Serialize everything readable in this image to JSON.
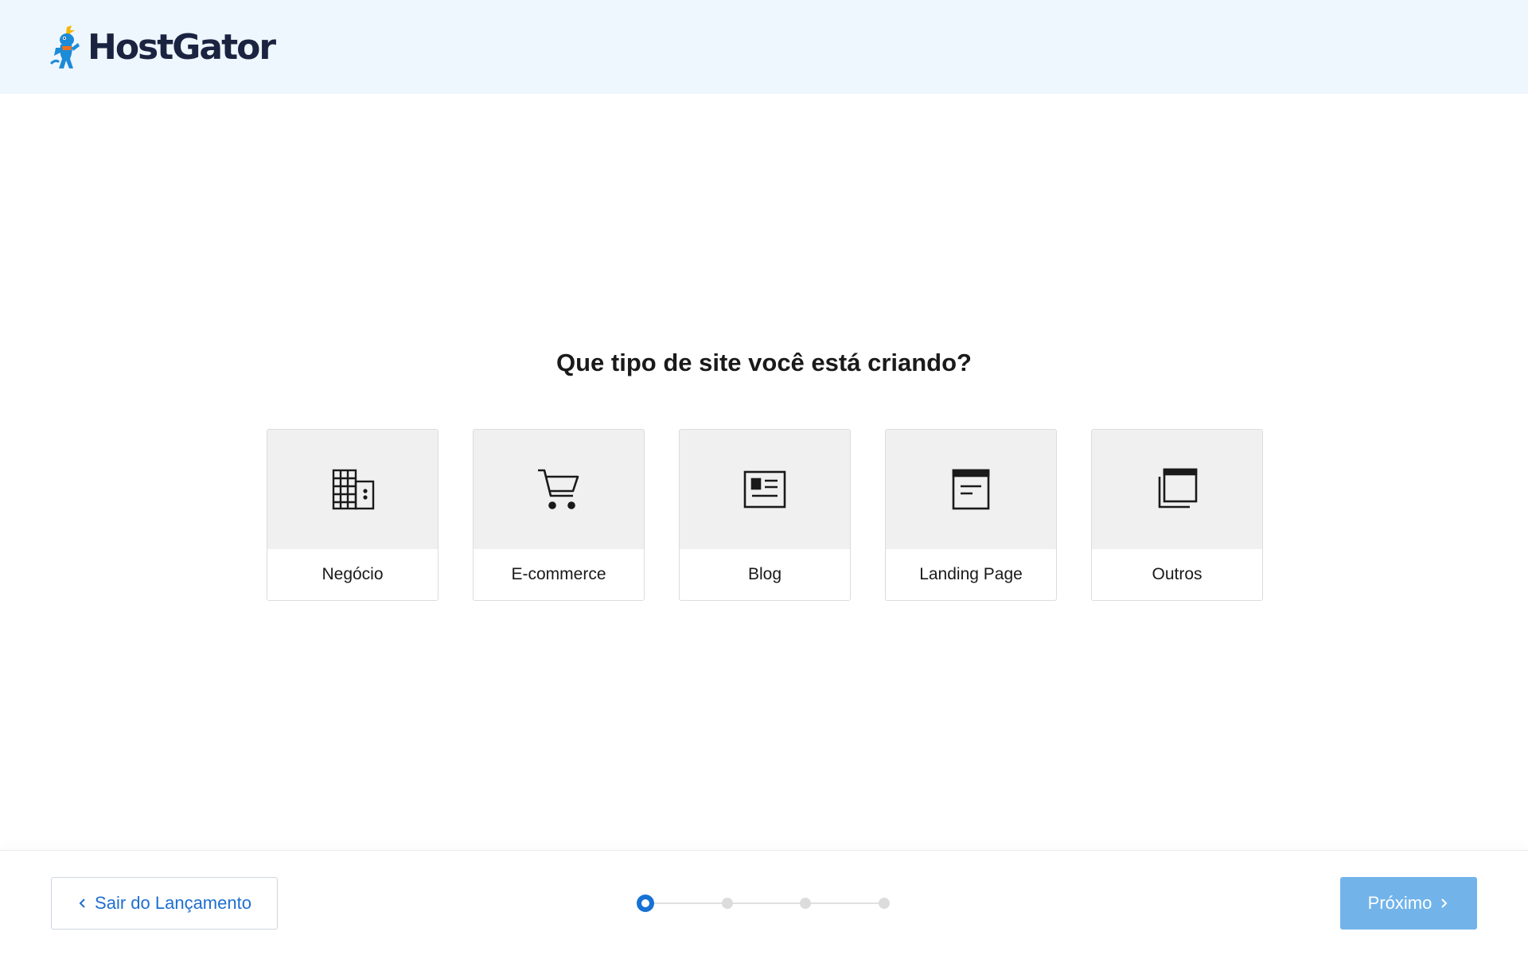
{
  "header": {
    "brand": "HostGator"
  },
  "main": {
    "question": "Que tipo de site você está criando?",
    "options": [
      {
        "label": "Negócio",
        "icon": "building-icon"
      },
      {
        "label": "E-commerce",
        "icon": "shopping-cart-icon"
      },
      {
        "label": "Blog",
        "icon": "newspaper-icon"
      },
      {
        "label": "Landing Page",
        "icon": "browser-window-icon"
      },
      {
        "label": "Outros",
        "icon": "stacked-windows-icon"
      }
    ]
  },
  "footer": {
    "exit_label": "Sair do Lançamento",
    "next_label": "Próximo",
    "stepper": {
      "current_step": 1,
      "total_steps": 4
    }
  },
  "colors": {
    "header_bg": "#eef6fe",
    "accent": "#1672d4",
    "next_button_disabled": "#72b4ea",
    "card_top_bg": "#f0f0f0"
  }
}
